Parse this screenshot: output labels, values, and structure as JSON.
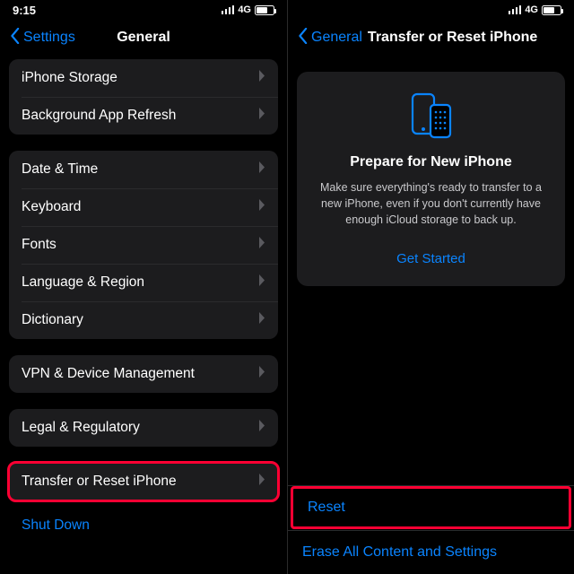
{
  "status": {
    "time": "9:15",
    "network": "4G"
  },
  "left": {
    "back_label": "Settings",
    "title": "General",
    "group1": [
      {
        "label": "iPhone Storage"
      },
      {
        "label": "Background App Refresh"
      }
    ],
    "group2": [
      {
        "label": "Date & Time"
      },
      {
        "label": "Keyboard"
      },
      {
        "label": "Fonts"
      },
      {
        "label": "Language & Region"
      },
      {
        "label": "Dictionary"
      }
    ],
    "group3": [
      {
        "label": "VPN & Device Management"
      }
    ],
    "group4": [
      {
        "label": "Legal & Regulatory"
      }
    ],
    "group5": [
      {
        "label": "Transfer or Reset iPhone"
      }
    ],
    "shutdown": "Shut Down"
  },
  "right": {
    "back_label": "General",
    "title": "Transfer or Reset iPhone",
    "card": {
      "title": "Prepare for New iPhone",
      "body": "Make sure everything's ready to transfer to a new iPhone, even if you don't currently have enough iCloud storage to back up.",
      "cta": "Get Started"
    },
    "bottom": {
      "reset": "Reset",
      "erase": "Erase All Content and Settings"
    }
  }
}
